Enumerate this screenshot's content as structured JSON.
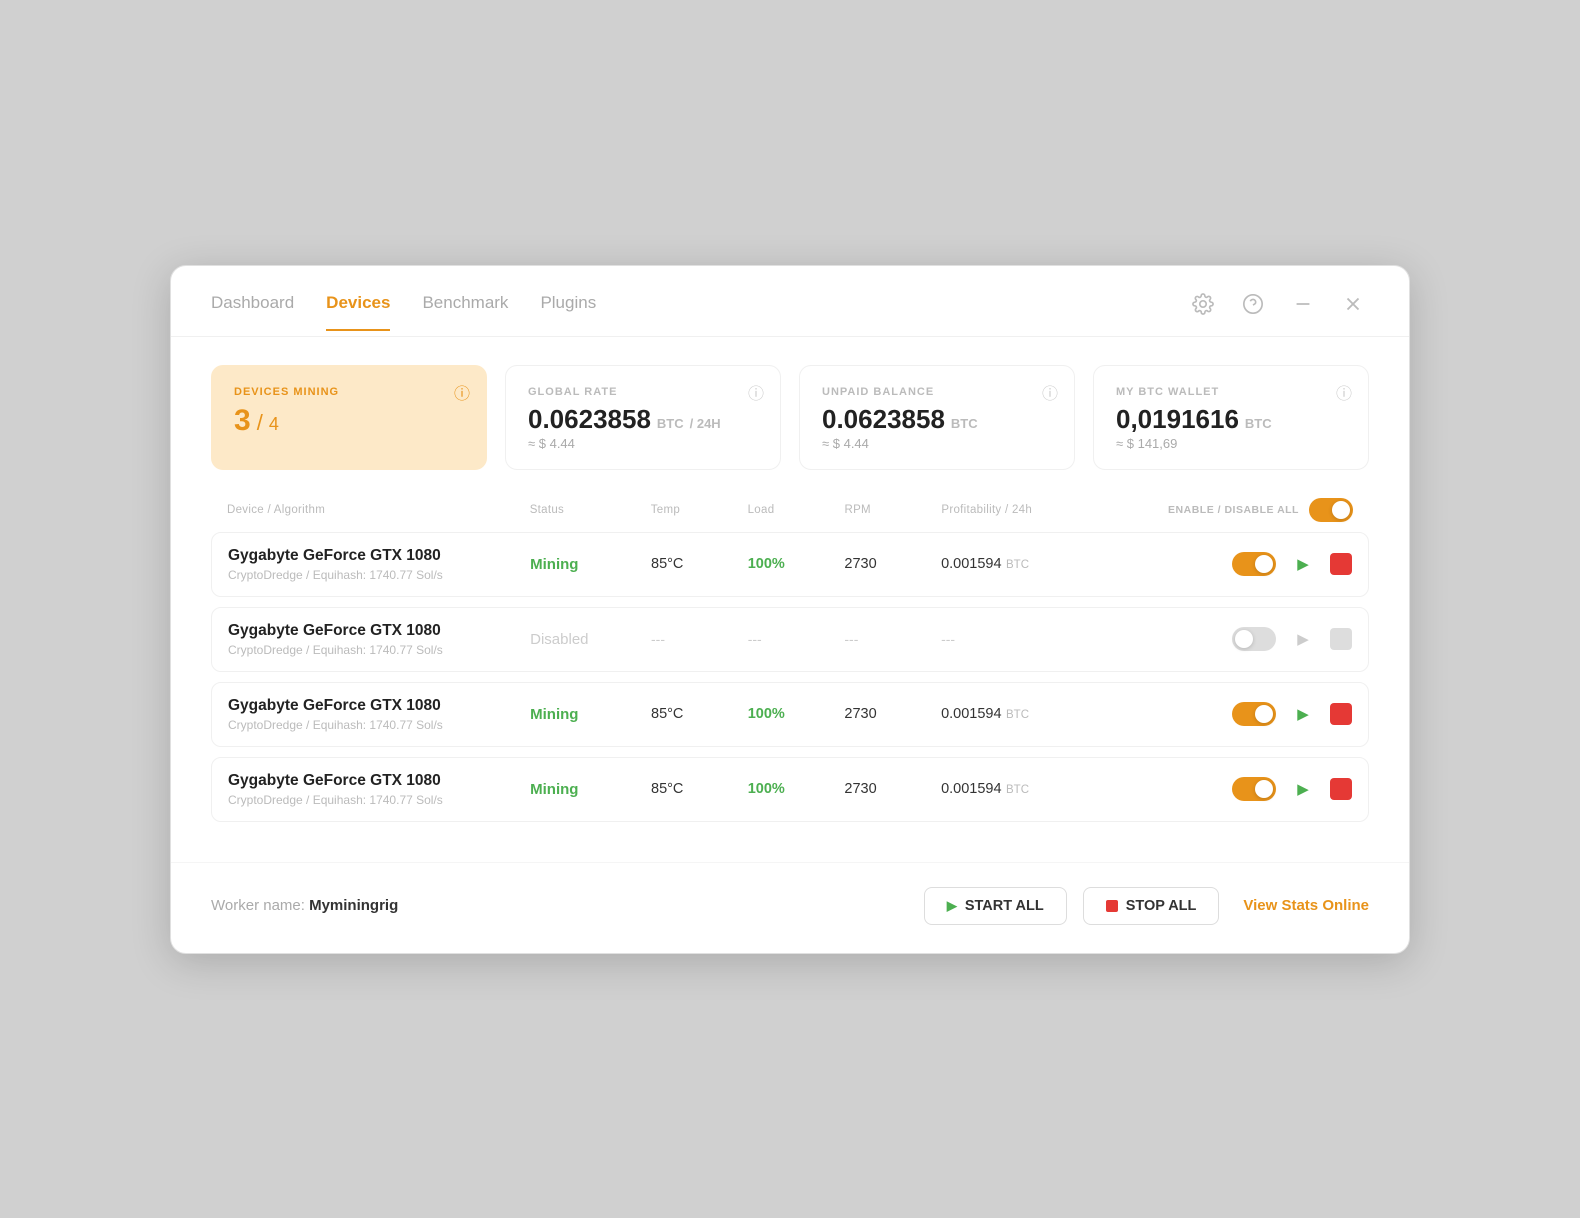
{
  "nav": {
    "tabs": [
      {
        "id": "dashboard",
        "label": "Dashboard",
        "active": false
      },
      {
        "id": "devices",
        "label": "Devices",
        "active": true
      },
      {
        "id": "benchmark",
        "label": "Benchmark",
        "active": false
      },
      {
        "id": "plugins",
        "label": "Plugins",
        "active": false
      }
    ]
  },
  "stats": {
    "devices_mining": {
      "label": "DEVICES MINING",
      "value": "3",
      "slash": "/",
      "denom": "4"
    },
    "global_rate": {
      "label": "GLOBAL RATE",
      "value": "0.0623858",
      "unit": "BTC",
      "per": "/ 24h",
      "sub": "≈ $ 4.44"
    },
    "unpaid_balance": {
      "label": "UNPAID BALANCE",
      "value": "0.0623858",
      "unit": "BTC",
      "sub": "≈ $ 4.44"
    },
    "my_btc_wallet": {
      "label": "MY BTC WALLET",
      "value": "0,0191616",
      "unit": "BTC",
      "sub": "≈ $ 141,69"
    }
  },
  "table": {
    "headers": {
      "device": "Device / Algorithm",
      "status": "Status",
      "temp": "Temp",
      "load": "Load",
      "rpm": "RPM",
      "profitability": "Profitability / 24h",
      "enable_label": "ENABLE / DISABLE ALL"
    },
    "rows": [
      {
        "id": "row1",
        "device_name": "Gygabyte GeForce GTX 1080",
        "algo": "CryptoDredge / Equihash: 1740.77 Sol/s",
        "status": "Mining",
        "status_type": "mining",
        "temp": "85°C",
        "load": "100%",
        "load_type": "active",
        "rpm": "2730",
        "profitability": "0.001594",
        "profit_unit": "BTC",
        "enabled": true
      },
      {
        "id": "row2",
        "device_name": "Gygabyte GeForce GTX 1080",
        "algo": "CryptoDredge / Equihash: 1740.77 Sol/s",
        "status": "Disabled",
        "status_type": "disabled",
        "temp": "---",
        "load": "---",
        "load_type": "disabled",
        "rpm": "---",
        "profitability": "---",
        "profit_unit": "",
        "enabled": false
      },
      {
        "id": "row3",
        "device_name": "Gygabyte GeForce GTX 1080",
        "algo": "CryptoDredge / Equihash: 1740.77 Sol/s",
        "status": "Mining",
        "status_type": "mining",
        "temp": "85°C",
        "load": "100%",
        "load_type": "active",
        "rpm": "2730",
        "profitability": "0.001594",
        "profit_unit": "BTC",
        "enabled": true
      },
      {
        "id": "row4",
        "device_name": "Gygabyte GeForce GTX 1080",
        "algo": "CryptoDredge / Equihash: 1740.77 Sol/s",
        "status": "Mining",
        "status_type": "mining",
        "temp": "85°C",
        "load": "100%",
        "load_type": "active",
        "rpm": "2730",
        "profitability": "0.001594",
        "profit_unit": "BTC",
        "enabled": true
      }
    ]
  },
  "footer": {
    "worker_prefix": "Worker name:",
    "worker_name": "Myminingrig",
    "start_all": "START ALL",
    "stop_all": "STOP ALL",
    "view_stats": "View Stats Online"
  }
}
